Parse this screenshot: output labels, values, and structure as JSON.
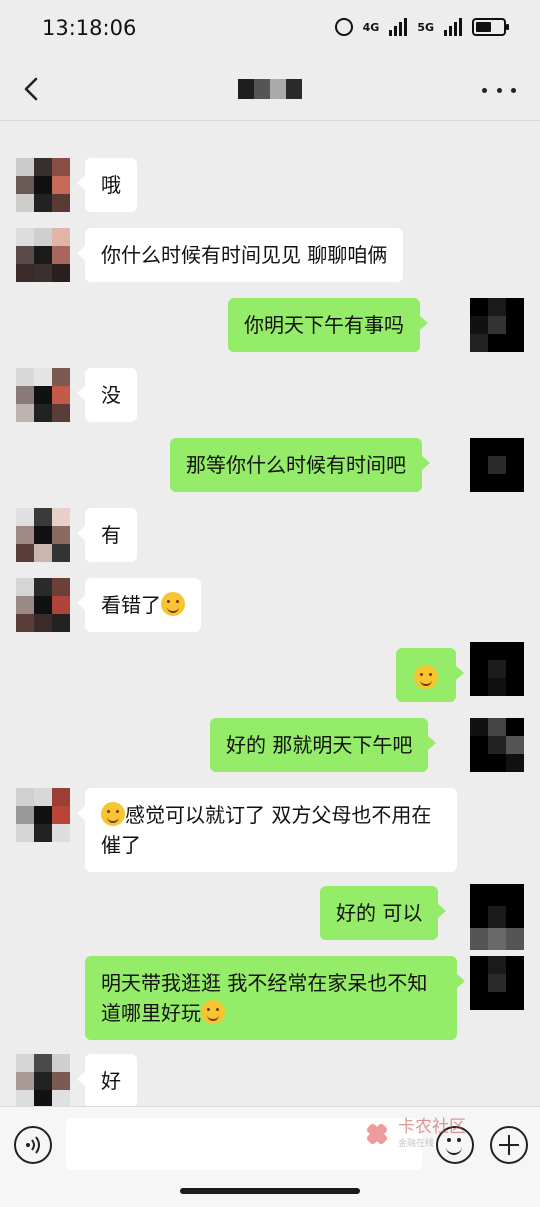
{
  "status": {
    "time": "13:18:06",
    "net1": "4G",
    "net2": "5G"
  },
  "header": {
    "title_redacted": true
  },
  "messages": [
    {
      "side": "in",
      "text": "哦"
    },
    {
      "side": "in",
      "text": "你什么时候有时间见见 聊聊咱俩"
    },
    {
      "side": "out",
      "text": "你明天下午有事吗"
    },
    {
      "side": "in",
      "text": "没"
    },
    {
      "side": "out",
      "text": "那等你什么时候有时间吧"
    },
    {
      "side": "in",
      "text": "有"
    },
    {
      "side": "in",
      "text": "看错了",
      "emoji_after": "rofl-emoji"
    },
    {
      "side": "out",
      "text": "",
      "emoji_only": "thinking-emoji"
    },
    {
      "side": "out",
      "text": "好的 那就明天下午吧"
    },
    {
      "side": "in",
      "text": "感觉可以就订了 双方父母也不用在催了",
      "emoji_before": "grin-emoji"
    },
    {
      "side": "out",
      "text": "好的  可以"
    },
    {
      "side": "out",
      "text": "明天带我逛逛  我不经常在家呆也不知道哪里好玩",
      "emoji_after": "thinking-emoji"
    },
    {
      "side": "in",
      "text": "好"
    }
  ],
  "watermark": {
    "title": "卡农社区",
    "subtitle": "金融在线"
  },
  "colors": {
    "incoming": "#ffffff",
    "outgoing": "#95ec69",
    "background": "#ededed"
  }
}
